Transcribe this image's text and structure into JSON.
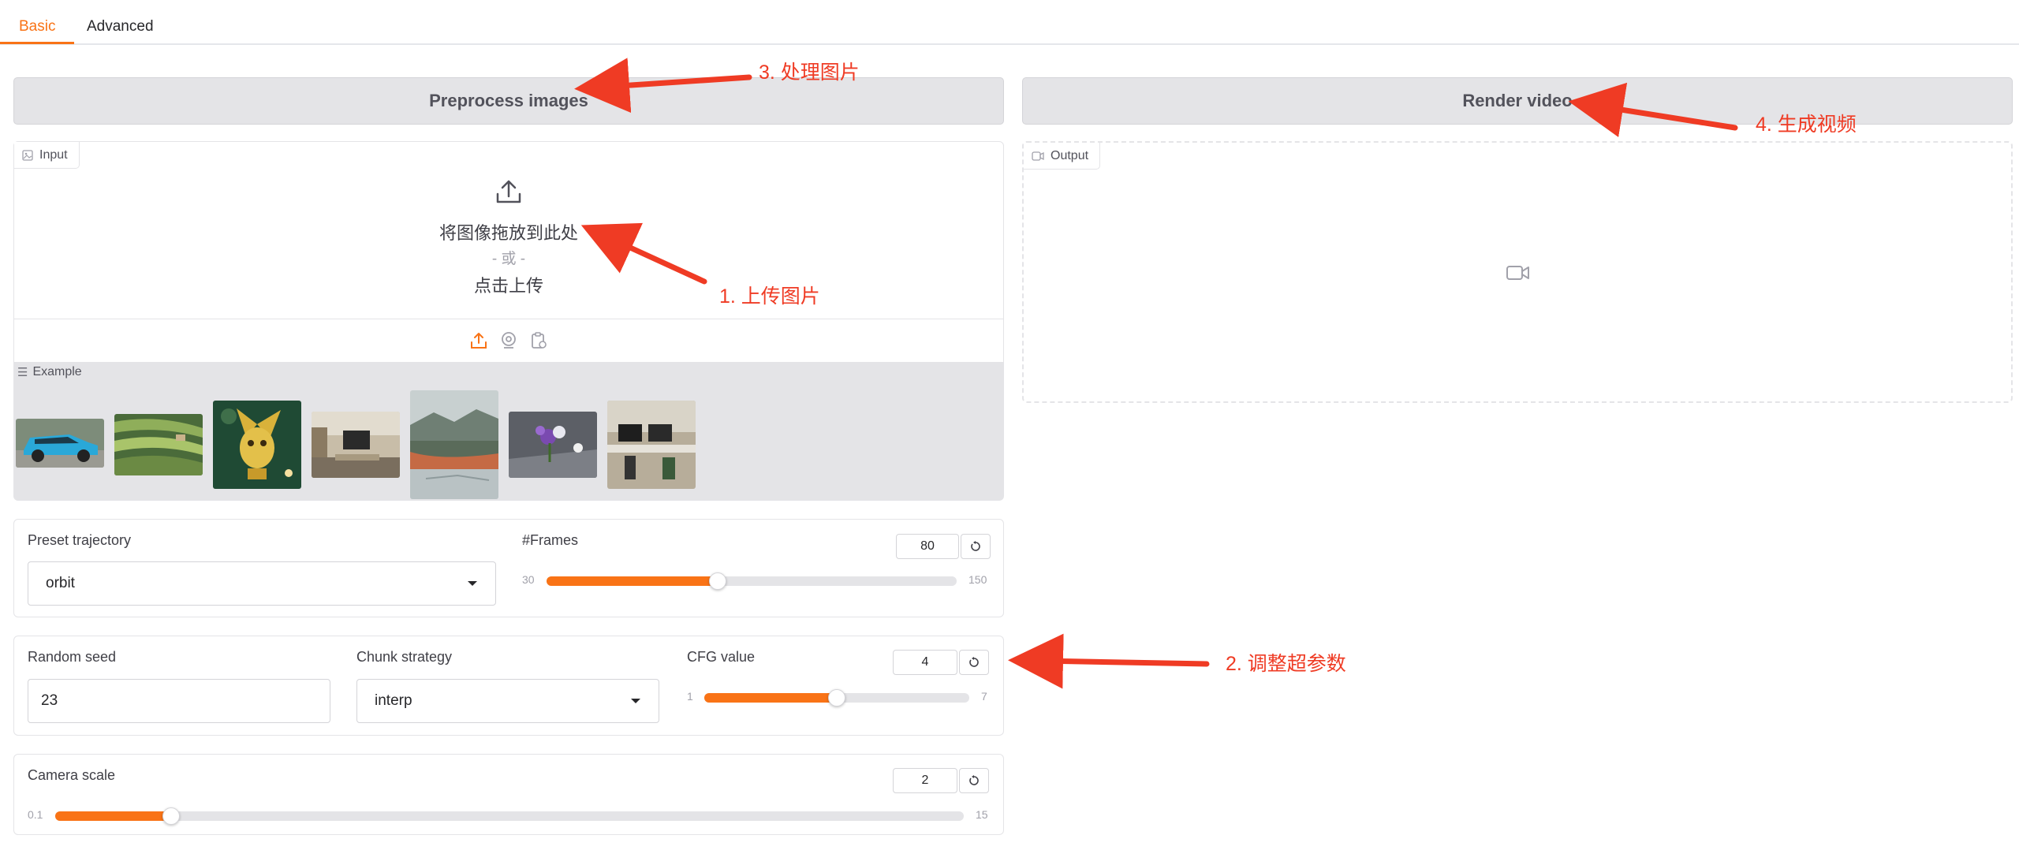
{
  "tabs": [
    {
      "label": "Basic",
      "active": true
    },
    {
      "label": "Advanced",
      "active": false
    }
  ],
  "buttons": {
    "preprocess": "Preprocess images",
    "render": "Render video"
  },
  "input_panel": {
    "label": "Input",
    "drop_text": "将图像拖放到此处",
    "or_text": "- 或 -",
    "click_text": "点击上传",
    "examples_label": "Example",
    "sources": [
      "upload-icon",
      "webcam-icon",
      "clipboard-icon"
    ]
  },
  "output_panel": {
    "label": "Output",
    "placeholder_icon": "video-icon"
  },
  "controls": {
    "preset_trajectory": {
      "label": "Preset trajectory",
      "value": "orbit"
    },
    "frames": {
      "label": "#Frames",
      "value": "80",
      "min": "30",
      "max": "150",
      "fraction": 0.4167
    },
    "random_seed": {
      "label": "Random seed",
      "value": "23"
    },
    "chunk_strategy": {
      "label": "Chunk strategy",
      "value": "interp"
    },
    "cfg_value": {
      "label": "CFG value",
      "value": "4",
      "min": "1",
      "max": "7",
      "fraction": 0.5
    },
    "camera_scale": {
      "label": "Camera scale",
      "value": "2",
      "min": "0.1",
      "max": "15",
      "fraction": 0.1275
    }
  },
  "annotations": {
    "step1": "1. 上传图片",
    "step2": "2. 调整超参数",
    "step3": "3. 处理图片",
    "step4": "4. 生成视频"
  },
  "colors": {
    "accent": "#f97316",
    "annotation_red": "#ef3b24",
    "button_gray": "#e4e4e7"
  }
}
